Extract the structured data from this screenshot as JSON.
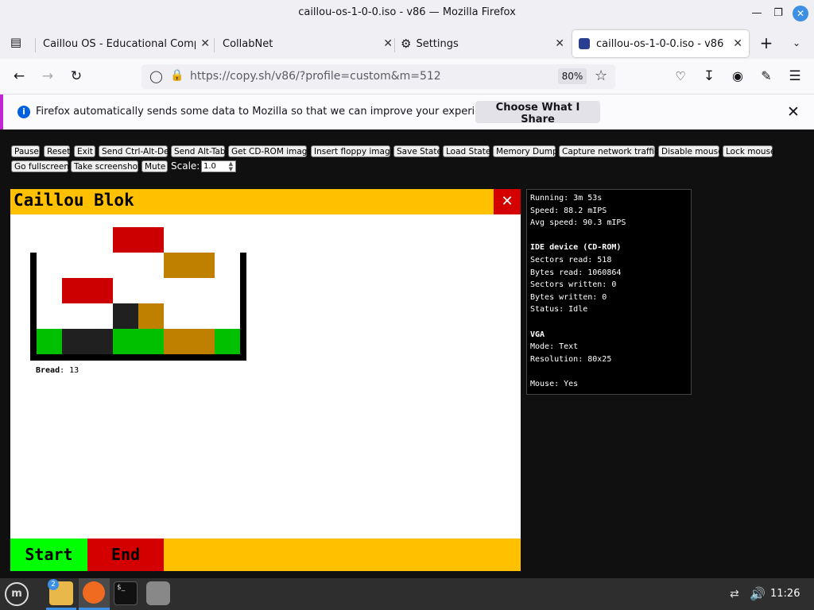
{
  "window": {
    "title": "caillou-os-1-0-0.iso - v86 — Mozilla Firefox"
  },
  "tabs": [
    {
      "label": "Caillou OS - Educational Compu"
    },
    {
      "label": "CollabNet"
    },
    {
      "label": "Settings"
    },
    {
      "label": "caillou-os-1-0-0.iso - v86"
    }
  ],
  "navbar": {
    "url": "https://copy.sh/v86/?profile=custom&m=512",
    "zoom": "80%"
  },
  "notification": {
    "message": "Firefox automatically sends some data to Mozilla so that we can improve your experience.",
    "button": "Choose What I Share"
  },
  "controls": {
    "buttons": [
      "Pause",
      "Reset",
      "Exit",
      "Send Ctrl-Alt-Del",
      "Send Alt-Tab",
      "Get CD-ROM image",
      "Insert floppy image",
      "Save State",
      "Load State",
      "Memory Dump",
      "Capture network traffic",
      "Disable mouse",
      "Lock mouse",
      "Go fullscreen",
      "Take screenshot",
      "Mute"
    ],
    "scale_label": "Scale:",
    "scale_value": "1.0"
  },
  "game": {
    "title": "Caillou Blok",
    "bread_label": "Bread",
    "bread_value": ": 13",
    "start": "Start",
    "end": "End",
    "colors": {
      "red": "#cc0000",
      "orange": "#bf8000",
      "green": "#00c000",
      "dark": "#202020",
      "yellow": "#ffc000"
    }
  },
  "stats": {
    "running": "Running: 3m 53s",
    "speed": "Speed: 88.2 mIPS",
    "avg_speed": "Avg speed: 90.3 mIPS",
    "ide_header": "IDE device (CD-ROM)",
    "sectors_read": "Sectors read: 518",
    "bytes_read": "Bytes read: 1060864",
    "sectors_written": "Sectors written: 0",
    "bytes_written": "Bytes written: 0",
    "status": "Status: Idle",
    "vga_header": "VGA",
    "mode": "Mode: Text",
    "resolution": "Resolution: 80x25",
    "mouse": "Mouse: Yes"
  },
  "taskbar": {
    "badge": "2",
    "clock": "11:26"
  }
}
